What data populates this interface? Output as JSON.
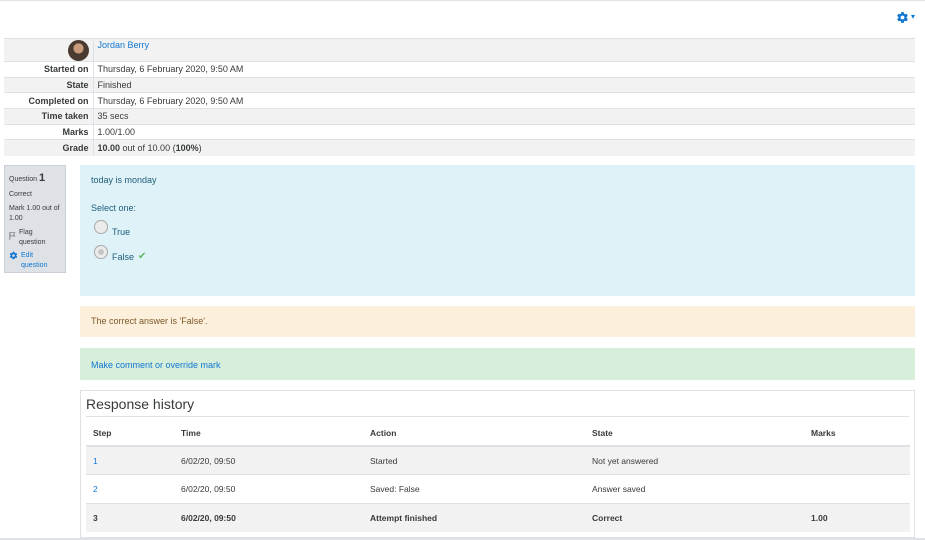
{
  "header": {
    "settings_icon": "gear-icon",
    "accent_color": "#1177d1"
  },
  "summary": {
    "user_name": "Jordan Berry",
    "rows": [
      {
        "label": "Started on",
        "value": "Thursday, 6 February 2020, 9:50 AM"
      },
      {
        "label": "State",
        "value": "Finished"
      },
      {
        "label": "Completed on",
        "value": "Thursday, 6 February 2020, 9:50 AM"
      },
      {
        "label": "Time taken",
        "value": "35 secs"
      },
      {
        "label": "Marks",
        "value": "1.00/1.00"
      }
    ],
    "grade": {
      "label": "Grade",
      "score": "10.00",
      "middle": " out of 10.00 (",
      "percent": "100%",
      "end": ")"
    }
  },
  "question_info": {
    "question_word": "Question ",
    "number": "1",
    "state": "Correct",
    "mark": "Mark 1.00 out of 1.00",
    "flag": "Flag question",
    "edit": "Edit question"
  },
  "question": {
    "text": "today is monday",
    "prompt": "Select one:",
    "options": [
      {
        "label": "True",
        "checked": false
      },
      {
        "label": "False",
        "checked": true
      }
    ]
  },
  "feedback": {
    "correct_answer": "The correct answer is 'False'."
  },
  "comment_link": "Make comment or override mark",
  "history": {
    "title": "Response history",
    "columns": [
      "Step",
      "Time",
      "Action",
      "State",
      "Marks"
    ],
    "rows": [
      {
        "step": "1",
        "time": "6/02/20, 09:50",
        "action": "Started",
        "state": "Not yet answered",
        "marks": ""
      },
      {
        "step": "2",
        "time": "6/02/20, 09:50",
        "action": "Saved: False",
        "state": "Answer saved",
        "marks": ""
      },
      {
        "step": "3",
        "time": "6/02/20, 09:50",
        "action": "Attempt finished",
        "state": "Correct",
        "marks": "1.00"
      }
    ]
  }
}
